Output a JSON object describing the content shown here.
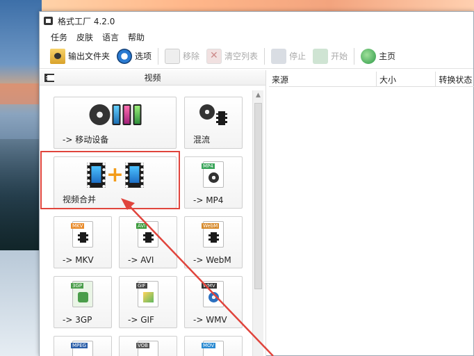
{
  "window": {
    "title": "格式工厂 4.2.0"
  },
  "menu": [
    "任务",
    "皮肤",
    "语言",
    "帮助"
  ],
  "toolbar": {
    "output_folder": "输出文件夹",
    "options": "选项",
    "remove": "移除",
    "clear_list": "清空列表",
    "stop": "停止",
    "start": "开始",
    "home": "主页"
  },
  "category": {
    "title": "视频"
  },
  "tiles": {
    "mobile": "-> 移动设备",
    "mix": "混流",
    "merge": "视频合并",
    "mp4": "-> MP4",
    "mkv": "-> MKV",
    "avi": "-> AVI",
    "webm": "-> WebM",
    "threegp": "-> 3GP",
    "gif": "-> GIF",
    "wmv": "-> WMV",
    "tags": {
      "mp4": "MP4",
      "mkv": "MKV",
      "avi": "AVI",
      "webm": "WebM",
      "threegp": "3GP",
      "gif": "GIF",
      "wmv": "WMV",
      "mpeg": "MPEG",
      "vob": "VOB",
      "mov": "MOV"
    }
  },
  "list": {
    "col_source": "来源",
    "col_size": "大小",
    "col_status": "转换状态"
  },
  "colors": {
    "highlight": "#e0443c",
    "accent_orange": "#f39c1a"
  }
}
